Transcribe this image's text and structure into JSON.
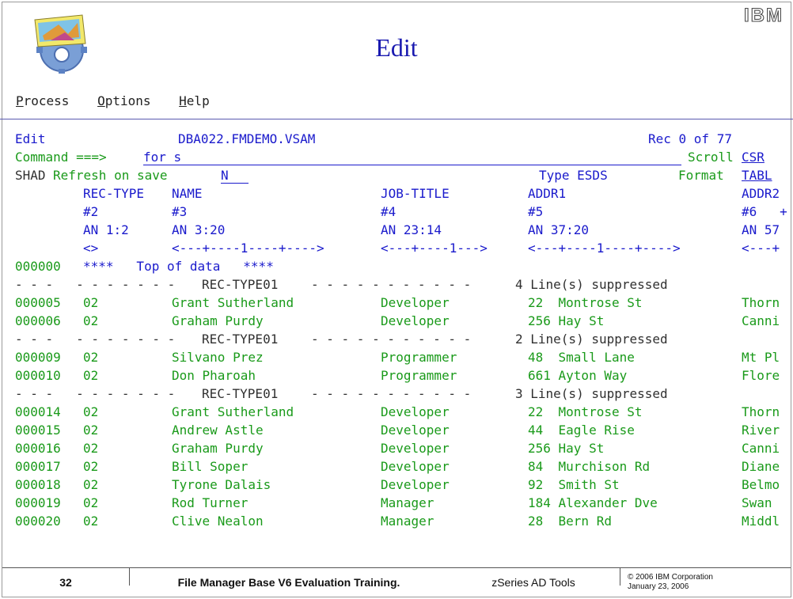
{
  "slide": {
    "title": "Edit",
    "brand": "IBM",
    "menu": [
      "Process",
      "Options",
      "Help"
    ],
    "footer": {
      "page": "32",
      "course": "File Manager Base V6 Evaluation Training.",
      "product": "zSeries AD Tools",
      "copyright": "© 2006 IBM Corporation",
      "date": "January 23, 2006"
    }
  },
  "terminal": {
    "mode": "Edit",
    "dataset": "DBA022.FMDEMO.VSAM",
    "rec_label": "Rec 0 of 77",
    "command_label": "Command ===>",
    "command_value": "for s",
    "scroll_label": "Scroll",
    "scroll_value": "CSR",
    "shad_label": "SHAD",
    "refresh_label": "Refresh on save",
    "refresh_value": "N",
    "type_label": "Type ESDS",
    "format_label": "Format",
    "format_value": "TABL",
    "columns": [
      {
        "name": "REC-TYPE",
        "num": "#2",
        "def": "AN 1:2",
        "ruler": "<>"
      },
      {
        "name": "NAME",
        "num": "#3",
        "def": "AN 3:20",
        "ruler": "<---+----1----+---->"
      },
      {
        "name": "JOB-TITLE",
        "num": "#4",
        "def": "AN 23:14",
        "ruler": "<---+----1--->"
      },
      {
        "name": "ADDR1",
        "num": "#5",
        "def": "AN 37:20",
        "ruler": "<---+----1----+---->"
      },
      {
        "name": "ADDR2",
        "num": "#6   +",
        "def": "AN 57",
        "ruler": "<---+"
      }
    ],
    "top_of_data": {
      "line": "000000",
      "text": "****   Top of data   ****"
    },
    "rows": [
      {
        "kind": "sup",
        "rtype": "REC-TYPE01",
        "count": "4 Line(s) suppressed"
      },
      {
        "kind": "data",
        "line": "000005",
        "rtype": "02",
        "name": "Grant Sutherland",
        "job": "Developer",
        "addr1": "22  Montrose St",
        "addr2": "Thorn"
      },
      {
        "kind": "data",
        "line": "000006",
        "rtype": "02",
        "name": "Graham Purdy",
        "job": "Developer",
        "addr1": "256 Hay St",
        "addr2": "Canni"
      },
      {
        "kind": "sup",
        "rtype": "REC-TYPE01",
        "count": "2 Line(s) suppressed"
      },
      {
        "kind": "data",
        "line": "000009",
        "rtype": "02",
        "name": "Silvano Prez",
        "job": "Programmer",
        "addr1": "48  Small Lane",
        "addr2": "Mt Pl"
      },
      {
        "kind": "data",
        "line": "000010",
        "rtype": "02",
        "name": "Don Pharoah",
        "job": "Programmer",
        "addr1": "661 Ayton Way",
        "addr2": "Flore"
      },
      {
        "kind": "sup",
        "rtype": "REC-TYPE01",
        "count": "3 Line(s) suppressed"
      },
      {
        "kind": "data",
        "line": "000014",
        "rtype": "02",
        "name": "Grant Sutherland",
        "job": "Developer",
        "addr1": "22  Montrose St",
        "addr2": "Thorn"
      },
      {
        "kind": "data",
        "line": "000015",
        "rtype": "02",
        "name": "Andrew Astle",
        "job": "Developer",
        "addr1": "44  Eagle Rise",
        "addr2": "River"
      },
      {
        "kind": "data",
        "line": "000016",
        "rtype": "02",
        "name": "Graham Purdy",
        "job": "Developer",
        "addr1": "256 Hay St",
        "addr2": "Canni"
      },
      {
        "kind": "data",
        "line": "000017",
        "rtype": "02",
        "name": "Bill Soper",
        "job": "Developer",
        "addr1": "84  Murchison Rd",
        "addr2": "Diane"
      },
      {
        "kind": "data",
        "line": "000018",
        "rtype": "02",
        "name": "Tyrone Dalais",
        "job": "Developer",
        "addr1": "92  Smith St",
        "addr2": "Belmo"
      },
      {
        "kind": "data",
        "line": "000019",
        "rtype": "02",
        "name": "Rod Turner",
        "job": "Manager",
        "addr1": "184 Alexander Dve",
        "addr2": "Swan"
      },
      {
        "kind": "data",
        "line": "000020",
        "rtype": "02",
        "name": "Clive Nealon",
        "job": "Manager",
        "addr1": "28  Bern Rd",
        "addr2": "Middl"
      }
    ],
    "colors": {
      "text_blue": "#1a1acc",
      "text_green": "#1a9a1a",
      "title_blue": "#1a1ab0"
    }
  }
}
